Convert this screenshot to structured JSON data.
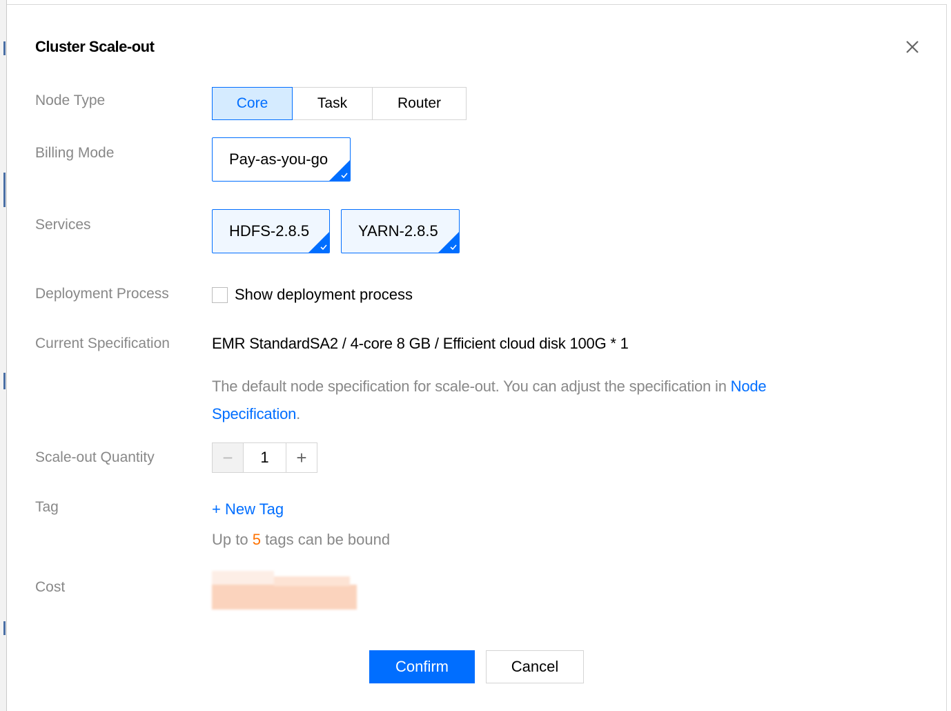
{
  "dialog": {
    "title": "Cluster Scale-out",
    "close_icon": "close-icon"
  },
  "labels": {
    "node_type": "Node Type",
    "billing_mode": "Billing Mode",
    "services": "Services",
    "deployment_process": "Deployment Process",
    "current_specification": "Current Specification",
    "scale_out_quantity": "Scale-out Quantity",
    "tag": "Tag",
    "cost": "Cost"
  },
  "node_type": {
    "options": [
      "Core",
      "Task",
      "Router"
    ],
    "selected": "Core"
  },
  "billing_mode": {
    "selected": "Pay-as-you-go"
  },
  "services": {
    "items": [
      "HDFS-2.8.5",
      "YARN-2.8.5"
    ]
  },
  "deployment": {
    "checkbox_label": "Show deployment process",
    "checked": false
  },
  "specification": {
    "value": "EMR StandardSA2 / 4-core 8 GB / Efficient cloud disk 100G * 1",
    "hint_prefix": "The default node specification for scale-out. You can adjust the specification in ",
    "hint_link": "Node Specification",
    "hint_suffix": "."
  },
  "quantity": {
    "value": "1",
    "decrement": "−",
    "increment": "+"
  },
  "tag": {
    "new_tag_label": "+ New Tag",
    "hint_prefix": "Up to ",
    "hint_count": "5",
    "hint_suffix": " tags can be bound"
  },
  "footer": {
    "confirm_label": "Confirm",
    "cancel_label": "Cancel"
  },
  "colors": {
    "accent": "#006eff",
    "selected_bg": "#d5ebff",
    "label_gray": "#888888",
    "highlight_number": "#ff7200"
  }
}
